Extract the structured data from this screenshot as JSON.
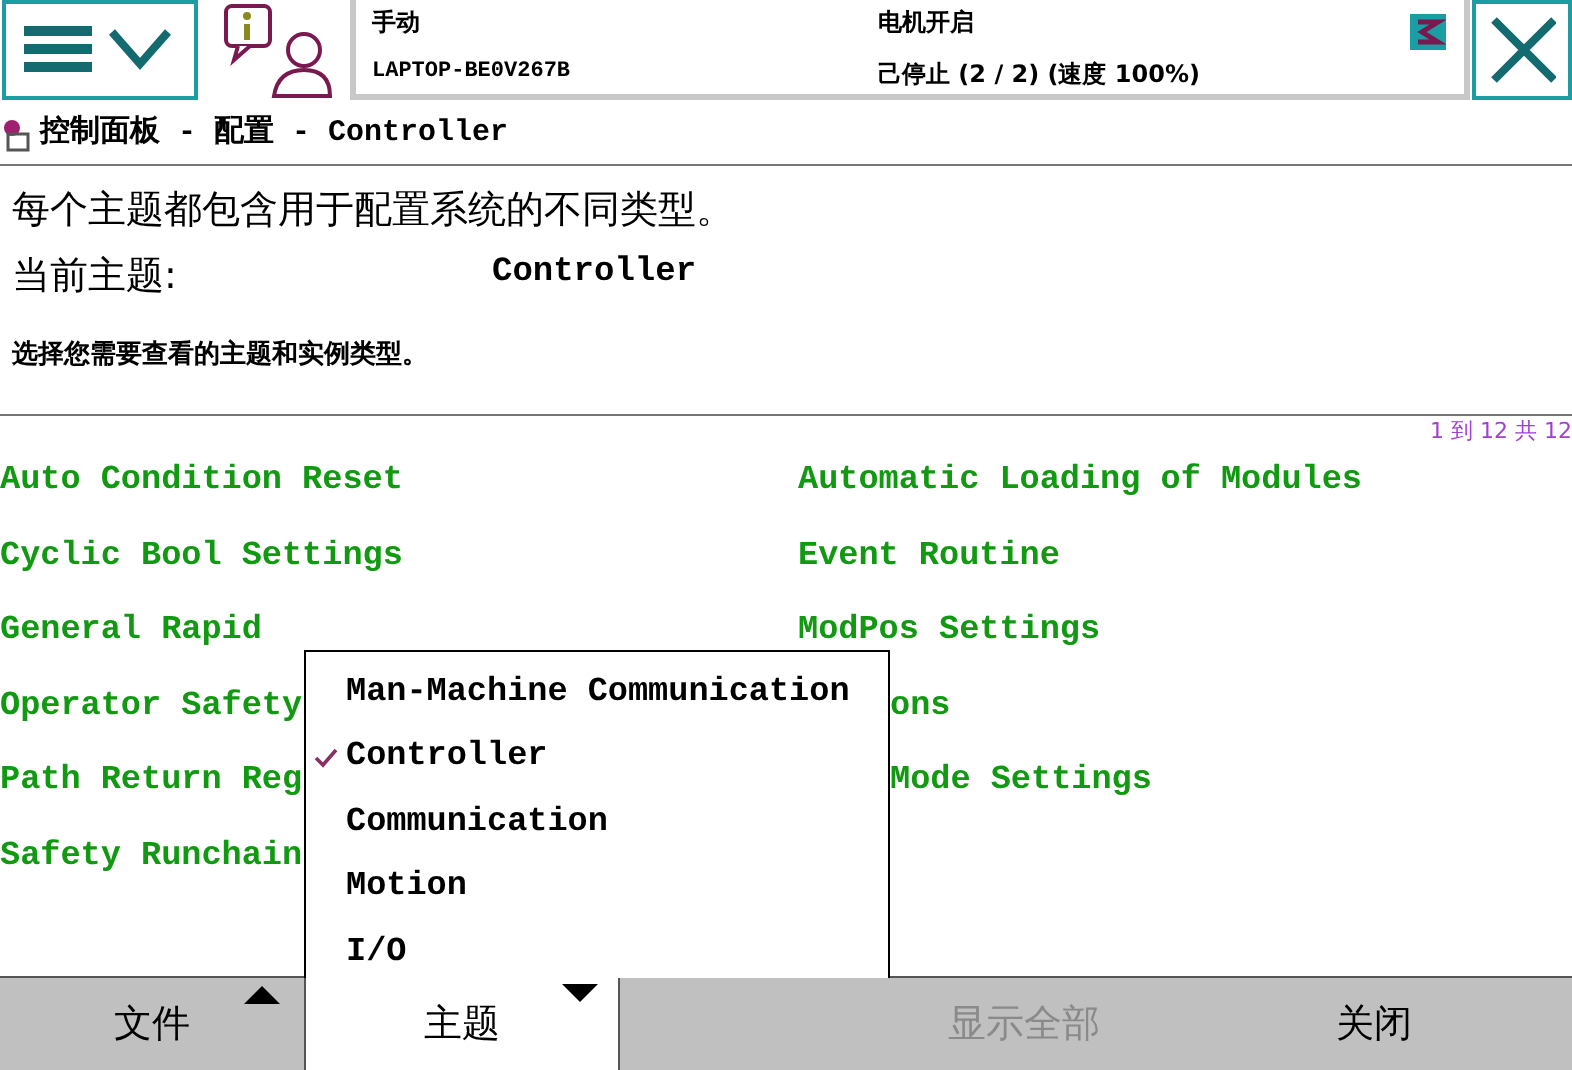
{
  "status": {
    "mode": "手动",
    "host": "LAPTOP-BE0V267B",
    "motor": "电机开启",
    "state": "己停止 (2 / 2) (速度 100%)"
  },
  "breadcrumb": "控制面板 - 配置 - Controller",
  "intro": "每个主题都包含用于配置系统的不同类型。",
  "current_topic": {
    "label": "当前主题:",
    "value": "Controller"
  },
  "instruction": "选择您需要查看的主题和实例类型。",
  "paging": "1 到 12 共 12",
  "types": [
    {
      "text": "Auto Condition Reset",
      "kind": "full"
    },
    {
      "text": "Automatic Loading of Modules",
      "kind": "full"
    },
    {
      "text": "Cyclic Bool Settings",
      "kind": "full"
    },
    {
      "text": "Event Routine",
      "kind": "full"
    },
    {
      "text": "General Rapid",
      "kind": "full"
    },
    {
      "text": "ModPos Settings",
      "kind": "full"
    },
    {
      "text": "Operator Safety",
      "kind": "full"
    },
    {
      "text": "ons",
      "kind": "partial"
    },
    {
      "text": "Path Return Reg",
      "kind": "full"
    },
    {
      "text": "Mode Settings",
      "kind": "partial"
    },
    {
      "text": "Safety Runchain",
      "kind": "full"
    }
  ],
  "topic_menu": [
    {
      "label": "Man-Machine Communication",
      "checked": false
    },
    {
      "label": "Controller",
      "checked": true
    },
    {
      "label": "Communication",
      "checked": false
    },
    {
      "label": "Motion",
      "checked": false
    },
    {
      "label": "I/O",
      "checked": false
    }
  ],
  "bottom_bar": [
    {
      "label": "文件",
      "kind": "menu-up",
      "selected": false,
      "disabled": false
    },
    {
      "label": "主题",
      "kind": "menu-down",
      "selected": true,
      "disabled": false
    },
    {
      "label": "显示全部",
      "kind": "plain",
      "selected": false,
      "disabled": true
    },
    {
      "label": "关闭",
      "kind": "plain",
      "selected": false,
      "disabled": false
    }
  ]
}
